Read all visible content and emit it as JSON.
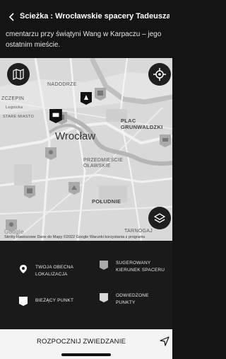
{
  "header": {
    "back_icon": "chevron-left-icon",
    "title": "Ścieżka : Wrocławskie spacery Tadeusza Róże...",
    "description": "cmentarzu przy świątyni Wang w Karpaczu – jego ostatnim mieście."
  },
  "map": {
    "labels": {
      "nadodrze": "NADODRZE",
      "zczepin": "ZCZEPIN",
      "legnicka": "Legnicka",
      "stare_miasto": "STARE MIASTO",
      "plac_grunwaldzki": "PLAC GRUNWALDZKI",
      "wroclaw": "Wrocław",
      "przedmiescie": "PRZEDMIEŚCIE OŁAWSKIE",
      "poludnie": "POŁUDNIE",
      "tarnogaj": "TARNOGAJ",
      "google": "Google"
    },
    "attribution": "Skróty klawiszowe   Dane do Mapy ©2022 Google   Warunki korzystania z programu"
  },
  "legend": {
    "items": [
      {
        "icon": "location-pin-icon",
        "label": "TWOJA OBECNA LOKALIZACJA"
      },
      {
        "icon": "suggested-direction-icon",
        "label": "SUGEROWANY KIERUNEK SPACERU"
      },
      {
        "icon": "current-point-icon",
        "label": "BIEŻĄCY PUNKT"
      },
      {
        "icon": "visited-points-icon",
        "label": "ODWIEDZONE PUNKTY"
      }
    ]
  },
  "bottom": {
    "start_label": "ROZPOCZNIJ ZWIEDZANIE",
    "nav_icon": "navigation-arrow-icon"
  }
}
